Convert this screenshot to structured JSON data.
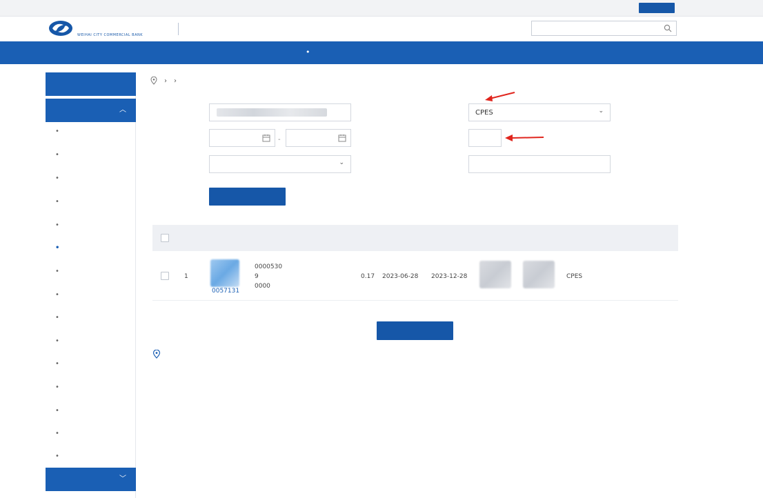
{
  "topbar": {
    "welcome": "",
    "links": [
      "",
      "",
      ""
    ],
    "logout": ""
  },
  "header": {
    "bank_name": "",
    "bank_en": "WEIHAI CITY COMMERCIAL BANK",
    "subtitle": "",
    "search_placeholder": ""
  },
  "nav": {
    "items": [
      "",
      "",
      "",
      "",
      "",
      "",
      "",
      "",
      "",
      "",
      "",
      ""
    ]
  },
  "sidebar": {
    "group1": "",
    "group2": "",
    "items": [
      "",
      "",
      "",
      "",
      "",
      "",
      "",
      "",
      "",
      "",
      "",
      "",
      "",
      "",
      ""
    ],
    "group3": ""
  },
  "breadcrumb": [
    "",
    "",
    ""
  ],
  "form": {
    "account_label": "",
    "due_date_label": "",
    "due_start_placeholder": "",
    "due_end_placeholder": "",
    "bill_status_label": "",
    "bill_status_value": "",
    "source_label": "",
    "source_value": "CPES",
    "split_label": "",
    "split_value": "",
    "range_no_label": "",
    "range_no_placeholder": "",
    "query_button": ""
  },
  "annotations": {
    "source_note": "",
    "split_note": ""
  },
  "table": {
    "headers": [
      "",
      "",
      "",
      "",
      "",
      "",
      "",
      "",
      "",
      "",
      "",
      "",
      ""
    ],
    "rows": [
      {
        "index": "1",
        "bill_no_tail": "0057131",
        "sub_range_lines": [
          "0000530",
          "9",
          "0000"
        ],
        "bill_type": "",
        "amount": "0.17",
        "issue_date": "2023-06-28",
        "due_date": "2023-12-28",
        "source": "CPES",
        "splittable": "",
        "action_detail": "",
        "action_transfer": ""
      }
    ]
  },
  "submit_button": "",
  "tips": {
    "title": "",
    "text": ""
  },
  "colors": {
    "brand_blue": "#1a5fb4",
    "button_blue": "#1657a8",
    "annotation_red": "#e0251d"
  }
}
